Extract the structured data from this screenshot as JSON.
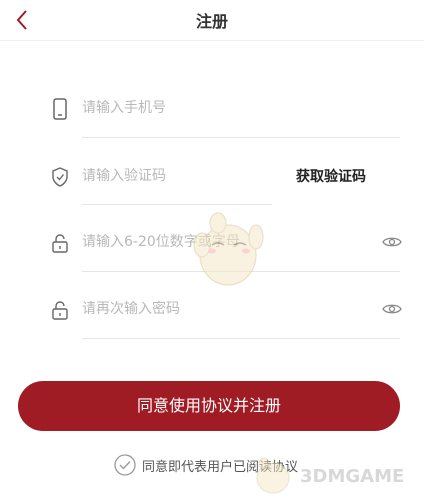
{
  "header": {
    "title": "注册"
  },
  "form": {
    "phone_placeholder": "请输入手机号",
    "code_placeholder": "请输入验证码",
    "get_code_label": "获取验证码",
    "password_placeholder": "请输入6-20位数字或字母",
    "confirm_placeholder": "请再次输入密码"
  },
  "submit_label": "同意使用协议并注册",
  "agreement_text": "同意即代表用户已阅读协议",
  "watermark": "3DMGAME",
  "colors": {
    "accent": "#a01c25"
  },
  "icons": [
    "back-arrow-icon",
    "phone-icon",
    "shield-check-icon",
    "lock-icon",
    "eye-icon",
    "checkmark-circle-icon"
  ]
}
